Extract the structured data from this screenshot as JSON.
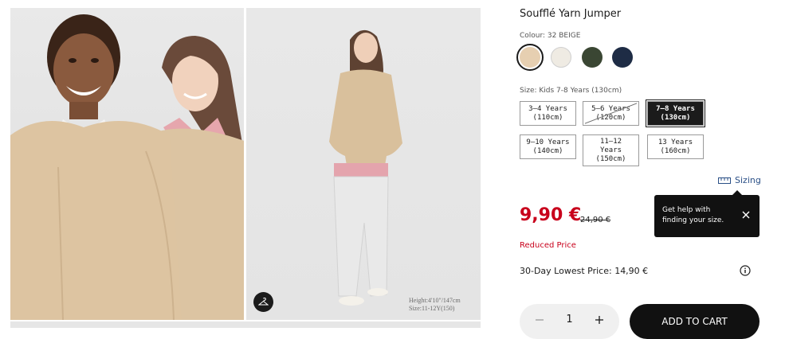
{
  "gallery": {
    "main_photo_alt": "",
    "model_caption": {
      "height": "Height:4'10\"/147cm",
      "size": "Size:11-12Y(150)"
    }
  },
  "product": {
    "title": "Soufflé Yarn Jumper",
    "colour_label": "Colour: 32 BEIGE",
    "colours": [
      {
        "name": "32 BEIGE",
        "hex": "#e6cfb1",
        "selected": true
      },
      {
        "name": "OFF WHITE",
        "hex": "#efebe3",
        "selected": false
      },
      {
        "name": "DARK GREEN",
        "hex": "#3a4633",
        "selected": false
      },
      {
        "name": "NAVY",
        "hex": "#1e2c45",
        "selected": false
      }
    ],
    "size_label": "Size: Kids 7-8 Years (130cm)",
    "sizes": [
      {
        "label": "3–4 Years\n(110cm)",
        "state": "available"
      },
      {
        "label": "5–6 Years\n(120cm)",
        "state": "unavailable"
      },
      {
        "label": "7–8 Years\n(130cm)",
        "state": "selected"
      },
      {
        "label": "9–10 Years\n(140cm)",
        "state": "available"
      },
      {
        "label": "11–12\nYears\n(150cm)",
        "state": "available"
      },
      {
        "label": "13 Years\n(160cm)",
        "state": "available"
      }
    ],
    "sizing_link": "Sizing",
    "tooltip": "Get help with finding your size.",
    "price": "9,90 €",
    "old_price": "24,90 €",
    "reduced_label": "Reduced Price",
    "lowest_price": "30-Day Lowest Price: 14,90 €",
    "quantity": "1",
    "add_to_cart": "ADD TO CART"
  },
  "colors": {
    "sale_red": "#c8001b",
    "link_blue": "#2a4f86",
    "dark": "#1b1b1b"
  }
}
